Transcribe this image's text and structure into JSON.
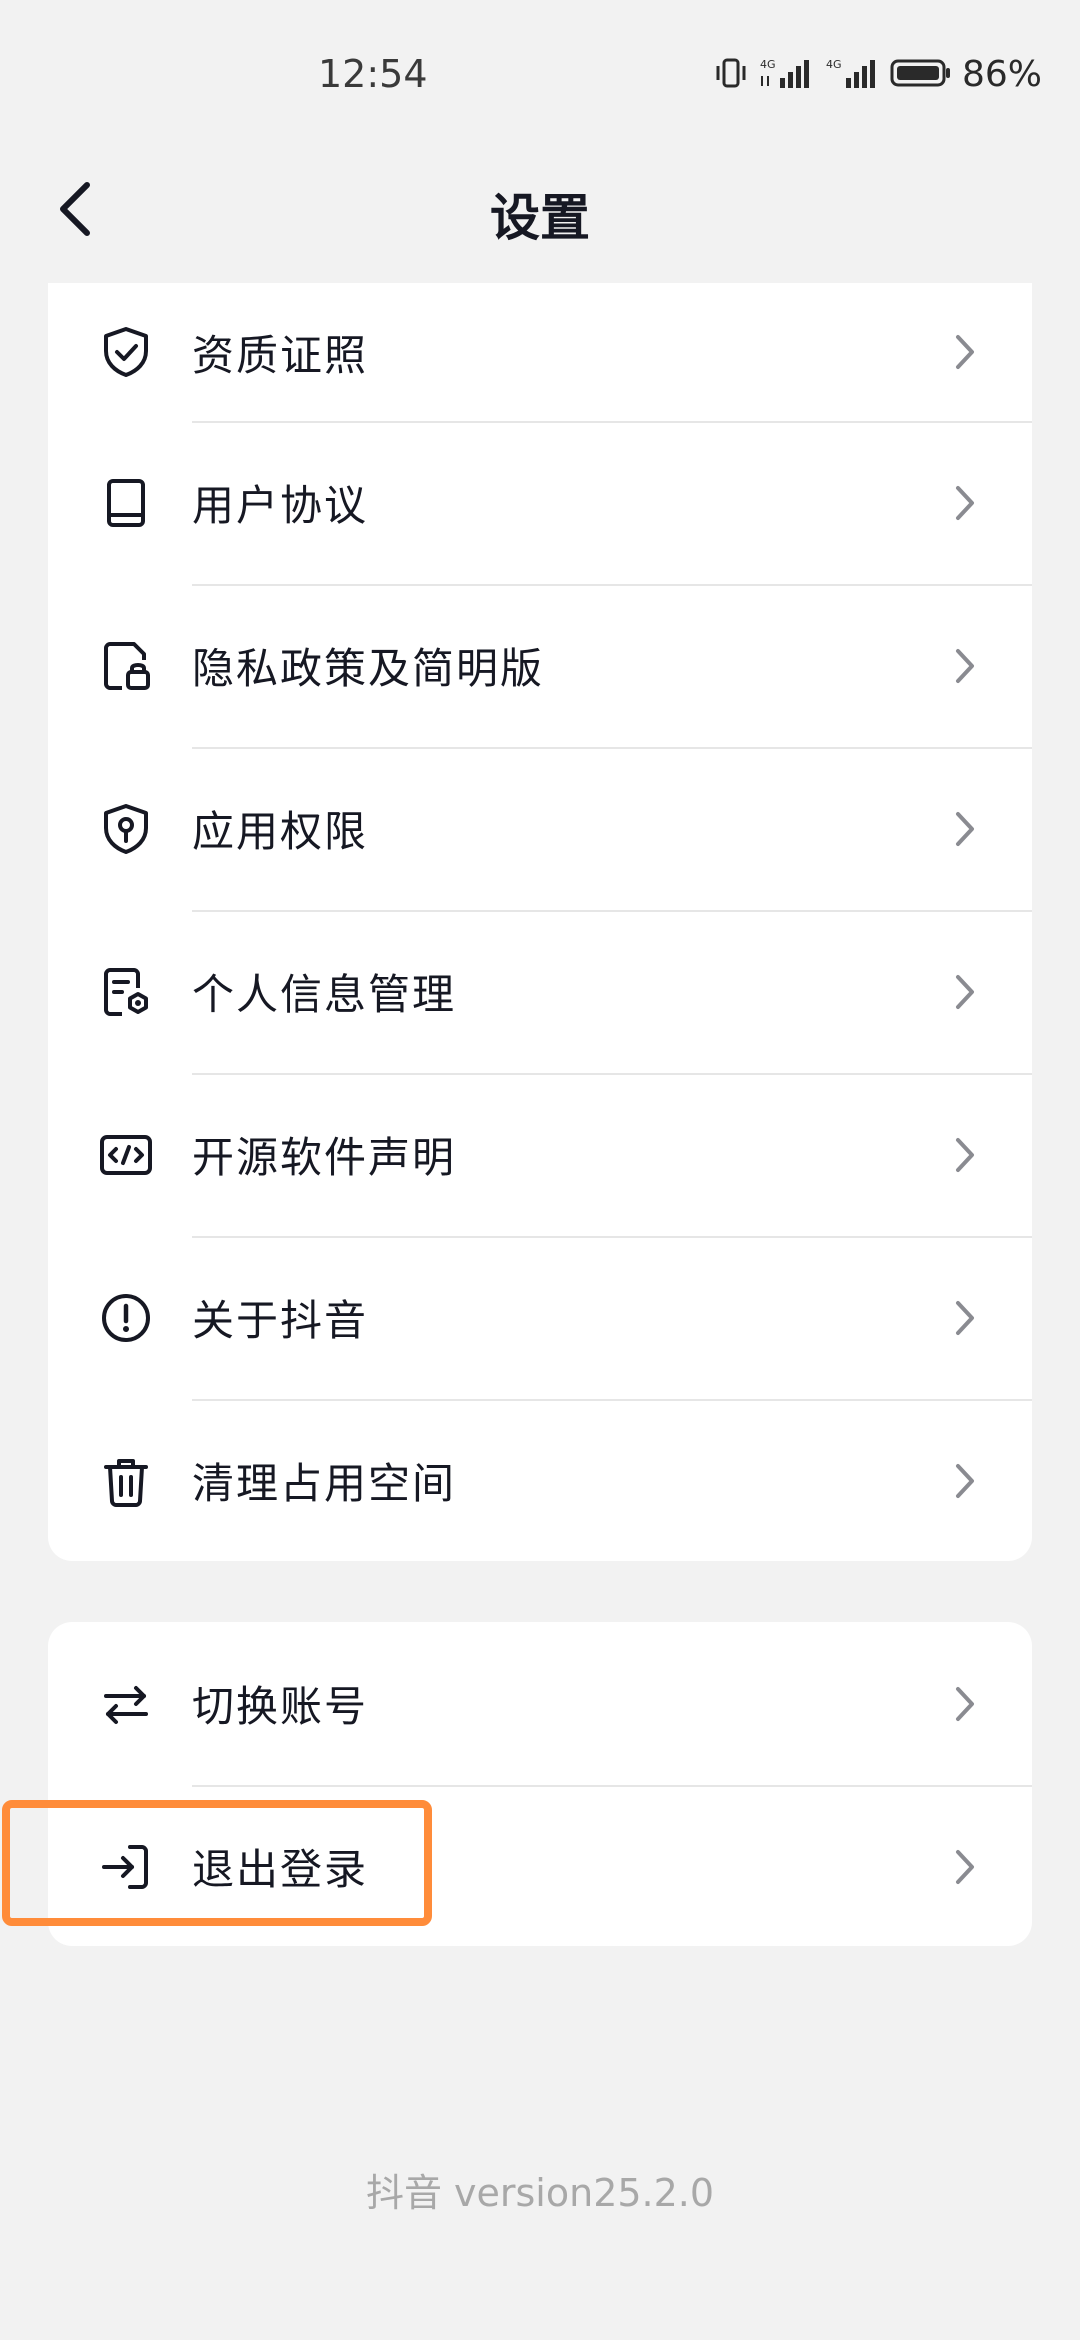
{
  "status_bar": {
    "time": "12:54",
    "network_1": "4G",
    "network_2": "4G",
    "battery_percent": "86%"
  },
  "header": {
    "title": "设置",
    "back_icon": "chevron-left-icon"
  },
  "settings_group_1": [
    {
      "label": "资质证照",
      "icon": "shield-check-icon"
    },
    {
      "label": "用户协议",
      "icon": "book-icon"
    },
    {
      "label": "隐私政策及简明版",
      "icon": "document-lock-icon"
    },
    {
      "label": "应用权限",
      "icon": "shield-key-icon"
    },
    {
      "label": "个人信息管理",
      "icon": "document-gear-icon"
    },
    {
      "label": "开源软件声明",
      "icon": "code-icon"
    },
    {
      "label": "关于抖音",
      "icon": "info-circle-icon"
    },
    {
      "label": "清理占用空间",
      "icon": "trash-icon"
    }
  ],
  "settings_group_2": [
    {
      "label": "切换账号",
      "icon": "switch-arrows-icon"
    },
    {
      "label": "退出登录",
      "icon": "logout-icon"
    }
  ],
  "footer": {
    "version": "抖音 version25.2.0"
  },
  "colors": {
    "background": "#f2f2f2",
    "card": "#ffffff",
    "text": "#161823",
    "highlight": "#ff8c3a",
    "version_text": "#a8a8a8"
  }
}
